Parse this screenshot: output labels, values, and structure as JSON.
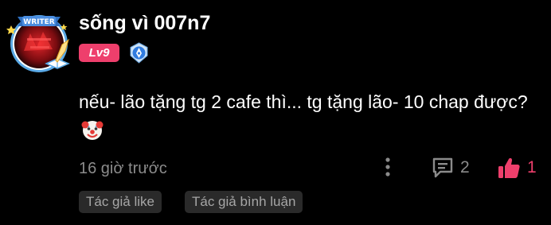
{
  "comment": {
    "author": {
      "name": "sống vì 007n7",
      "level": "Lv9",
      "avatar_frame_label": "WRITER",
      "avatar_icon": "writer-frame-avatar",
      "verified_icon": "quill-badge-icon"
    },
    "text": "nếu- lão tặng tg 2 cafe thì... tg tặng lão- 10 chap được?",
    "emoji": "clown-face",
    "timestamp": "16 giờ trước",
    "reply_count": "2",
    "like_count": "1",
    "tags": [
      "Tác giả like",
      "Tác giả bình luận"
    ]
  },
  "colors": {
    "background": "#000000",
    "accent": "#ee3f6c",
    "muted_text": "#8b8b8b",
    "tag_background": "#2a2a2a"
  }
}
